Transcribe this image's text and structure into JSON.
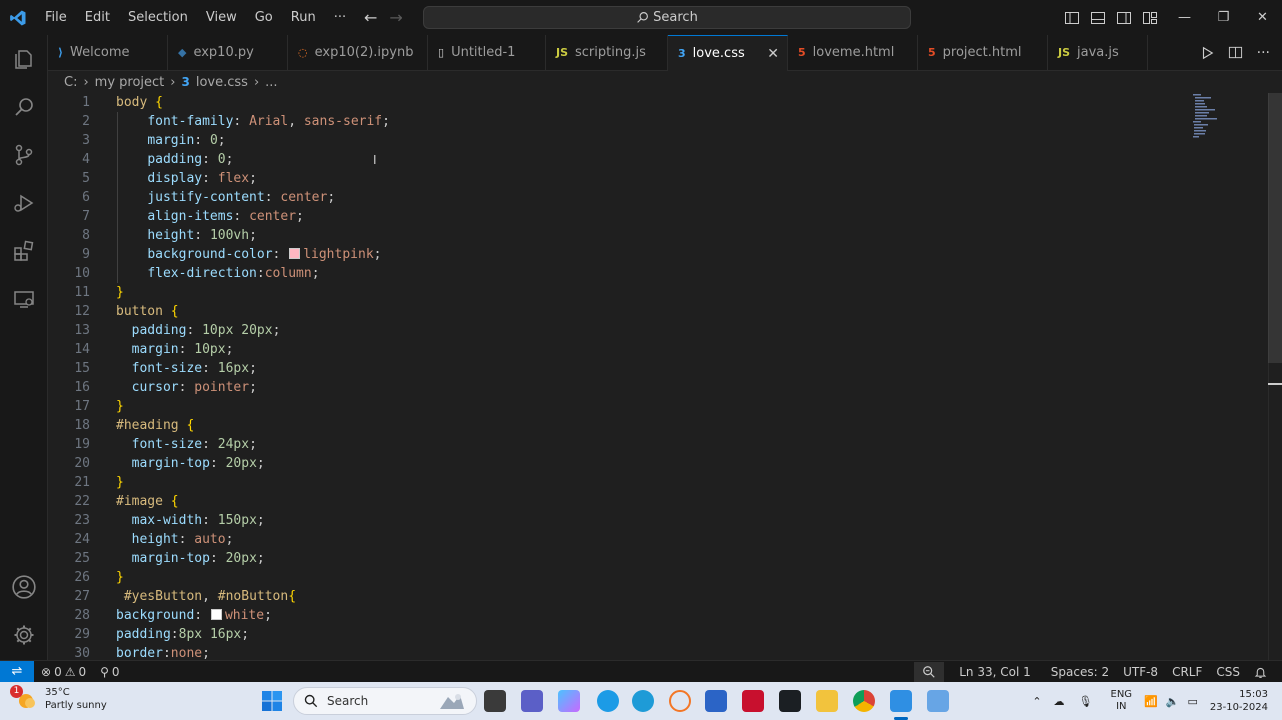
{
  "menu": [
    "File",
    "Edit",
    "Selection",
    "View",
    "Go",
    "Run",
    "···"
  ],
  "search": {
    "label": "Search"
  },
  "tabs": [
    {
      "label": "Welcome",
      "icon": "vscode-icon",
      "color": "#3c9be8",
      "width": 120
    },
    {
      "label": "exp10.py",
      "icon": "python-icon",
      "color": "#3572A5",
      "width": 120
    },
    {
      "label": "exp10(2).ipynb",
      "icon": "jupyter-icon",
      "color": "#f37626",
      "width": 140
    },
    {
      "label": "Untitled-1",
      "icon": "file-icon",
      "color": "#cccccc",
      "width": 118
    },
    {
      "label": "scripting.js",
      "icon": "js-icon",
      "color": "#cbcb41",
      "width": 122
    },
    {
      "label": "love.css",
      "icon": "css-icon",
      "color": "#42a5f5",
      "width": 120,
      "active": true
    },
    {
      "label": "loveme.html",
      "icon": "html-icon",
      "color": "#e44d26",
      "width": 130
    },
    {
      "label": "project.html",
      "icon": "html-icon",
      "color": "#e44d26",
      "width": 130
    },
    {
      "label": "java.js",
      "icon": "js-icon",
      "color": "#cbcb41",
      "width": 100
    }
  ],
  "breadcrumb": {
    "root": "C:",
    "folder": "my project",
    "file": "love.css",
    "tail": "..."
  },
  "code": [
    [
      [
        "sel",
        "body"
      ],
      [
        "punct",
        " "
      ],
      [
        "brace",
        "{"
      ]
    ],
    [
      [
        "punct",
        "    "
      ],
      [
        "prop",
        "font-family"
      ],
      [
        "punct",
        ": "
      ],
      [
        "val",
        "Arial"
      ],
      [
        "punct",
        ", "
      ],
      [
        "val",
        "sans-serif"
      ],
      [
        "punct",
        ";"
      ]
    ],
    [
      [
        "punct",
        "    "
      ],
      [
        "prop",
        "margin"
      ],
      [
        "punct",
        ": "
      ],
      [
        "num",
        "0"
      ],
      [
        "punct",
        ";"
      ]
    ],
    [
      [
        "punct",
        "    "
      ],
      [
        "prop",
        "padding"
      ],
      [
        "punct",
        ": "
      ],
      [
        "num",
        "0"
      ],
      [
        "punct",
        ";"
      ]
    ],
    [
      [
        "punct",
        "    "
      ],
      [
        "prop",
        "display"
      ],
      [
        "punct",
        ": "
      ],
      [
        "val",
        "flex"
      ],
      [
        "punct",
        ";"
      ]
    ],
    [
      [
        "punct",
        "    "
      ],
      [
        "prop",
        "justify-content"
      ],
      [
        "punct",
        ": "
      ],
      [
        "val",
        "center"
      ],
      [
        "punct",
        ";"
      ]
    ],
    [
      [
        "punct",
        "    "
      ],
      [
        "prop",
        "align-items"
      ],
      [
        "punct",
        ": "
      ],
      [
        "val",
        "center"
      ],
      [
        "punct",
        ";"
      ]
    ],
    [
      [
        "punct",
        "    "
      ],
      [
        "prop",
        "height"
      ],
      [
        "punct",
        ": "
      ],
      [
        "num",
        "100vh"
      ],
      [
        "punct",
        ";"
      ]
    ],
    [
      [
        "punct",
        "    "
      ],
      [
        "prop",
        "background-color"
      ],
      [
        "punct",
        ": "
      ],
      [
        "swatch",
        "#ffb6c1"
      ],
      [
        "val",
        "lightpink"
      ],
      [
        "punct",
        ";"
      ]
    ],
    [
      [
        "punct",
        "    "
      ],
      [
        "prop",
        "flex-direction"
      ],
      [
        "punct",
        ":"
      ],
      [
        "val",
        "column"
      ],
      [
        "punct",
        ";"
      ]
    ],
    [
      [
        "brace",
        "}"
      ]
    ],
    [
      [
        "sel",
        "button"
      ],
      [
        "punct",
        " "
      ],
      [
        "brace",
        "{"
      ]
    ],
    [
      [
        "punct",
        "  "
      ],
      [
        "prop",
        "padding"
      ],
      [
        "punct",
        ": "
      ],
      [
        "num",
        "10px"
      ],
      [
        "punct",
        " "
      ],
      [
        "num",
        "20px"
      ],
      [
        "punct",
        ";"
      ]
    ],
    [
      [
        "punct",
        "  "
      ],
      [
        "prop",
        "margin"
      ],
      [
        "punct",
        ": "
      ],
      [
        "num",
        "10px"
      ],
      [
        "punct",
        ";"
      ]
    ],
    [
      [
        "punct",
        "  "
      ],
      [
        "prop",
        "font-size"
      ],
      [
        "punct",
        ": "
      ],
      [
        "num",
        "16px"
      ],
      [
        "punct",
        ";"
      ]
    ],
    [
      [
        "punct",
        "  "
      ],
      [
        "prop",
        "cursor"
      ],
      [
        "punct",
        ": "
      ],
      [
        "val",
        "pointer"
      ],
      [
        "punct",
        ";"
      ]
    ],
    [
      [
        "brace",
        "}"
      ]
    ],
    [
      [
        "sel",
        "#heading"
      ],
      [
        "punct",
        " "
      ],
      [
        "brace",
        "{"
      ]
    ],
    [
      [
        "punct",
        "  "
      ],
      [
        "prop",
        "font-size"
      ],
      [
        "punct",
        ": "
      ],
      [
        "num",
        "24px"
      ],
      [
        "punct",
        ";"
      ]
    ],
    [
      [
        "punct",
        "  "
      ],
      [
        "prop",
        "margin-top"
      ],
      [
        "punct",
        ": "
      ],
      [
        "num",
        "20px"
      ],
      [
        "punct",
        ";"
      ]
    ],
    [
      [
        "brace",
        "}"
      ]
    ],
    [
      [
        "sel",
        "#image"
      ],
      [
        "punct",
        " "
      ],
      [
        "brace",
        "{"
      ]
    ],
    [
      [
        "punct",
        "  "
      ],
      [
        "prop",
        "max-width"
      ],
      [
        "punct",
        ": "
      ],
      [
        "num",
        "150px"
      ],
      [
        "punct",
        ";"
      ]
    ],
    [
      [
        "punct",
        "  "
      ],
      [
        "prop",
        "height"
      ],
      [
        "punct",
        ": "
      ],
      [
        "val",
        "auto"
      ],
      [
        "punct",
        ";"
      ]
    ],
    [
      [
        "punct",
        "  "
      ],
      [
        "prop",
        "margin-top"
      ],
      [
        "punct",
        ": "
      ],
      [
        "num",
        "20px"
      ],
      [
        "punct",
        ";"
      ]
    ],
    [
      [
        "brace",
        "}"
      ]
    ],
    [
      [
        "punct",
        " "
      ],
      [
        "sel",
        "#yesButton"
      ],
      [
        "punct",
        ", "
      ],
      [
        "sel",
        "#noButton"
      ],
      [
        "brace",
        "{"
      ]
    ],
    [
      [
        "prop",
        "background"
      ],
      [
        "punct",
        ": "
      ],
      [
        "swatch",
        "#ffffff"
      ],
      [
        "val",
        "white"
      ],
      [
        "punct",
        ";"
      ]
    ],
    [
      [
        "prop",
        "padding"
      ],
      [
        "punct",
        ":"
      ],
      [
        "num",
        "8px"
      ],
      [
        "punct",
        " "
      ],
      [
        "num",
        "16px"
      ],
      [
        "punct",
        ";"
      ]
    ],
    [
      [
        "prop",
        "border"
      ],
      [
        "punct",
        ":"
      ],
      [
        "val",
        "none"
      ],
      [
        "punct",
        ";"
      ]
    ]
  ],
  "status": {
    "errors": "0",
    "warnings": "0",
    "ports": "0",
    "position": "Ln 33, Col 1",
    "spaces": "Spaces: 2",
    "encoding": "UTF-8",
    "eol": "CRLF",
    "language": "CSS"
  },
  "taskbar": {
    "temp": "35°C",
    "weather": "Partly sunny",
    "badge": "1",
    "search": "Search",
    "lang1": "ENG",
    "lang2": "IN",
    "time": "15:03",
    "date": "23-10-2024"
  },
  "colors": {
    "accent": "#0078d4",
    "editor_bg": "#1f1f1f",
    "chrome_bg": "#181818"
  }
}
